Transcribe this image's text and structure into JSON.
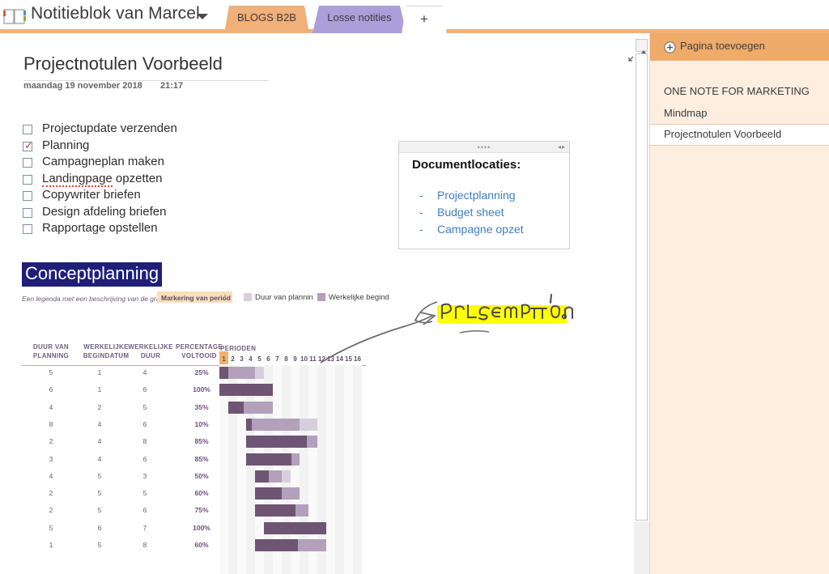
{
  "topbar": {
    "notebook_title": "Notitieblok van Marcel",
    "notebook_icon": "notebook-icon",
    "caret_icon": "chevron-down-icon",
    "tabs": [
      {
        "label": "BLOGS B2B",
        "color": "#efb07a",
        "active": true
      },
      {
        "label": "Losse notities",
        "color": "#ac9ed9",
        "active": false
      }
    ],
    "add_tab_label": "+"
  },
  "page": {
    "title": "Projectnotulen Voorbeeld",
    "date": "maandag 19 november 2018",
    "time": "21:17",
    "expand_icon": "expand-arrows-icon"
  },
  "checklist": [
    {
      "label": "Projectupdate verzenden",
      "checked": false,
      "misspelled": false
    },
    {
      "label": "Planning",
      "checked": true,
      "misspelled": false
    },
    {
      "label": "Campagneplan maken",
      "checked": false,
      "misspelled": false
    },
    {
      "label": "Landingpage opzetten",
      "checked": false,
      "misspelled": true,
      "misspelled_word": "Landingpage",
      "rest": " opzetten"
    },
    {
      "label": "Copywriter briefen",
      "checked": false,
      "misspelled": false
    },
    {
      "label": "Design afdeling briefen",
      "checked": false,
      "misspelled": false
    },
    {
      "label": "Rapportage opstellen",
      "checked": false,
      "misspelled": false
    }
  ],
  "doc_box": {
    "title": "Documentlocaties:",
    "dots": "••••",
    "resize_arrows": "◂▸",
    "links": [
      "Projectplanning",
      "Budget sheet",
      "Campagne opzet"
    ],
    "dash": "-",
    "link_color": "#3d7fc1"
  },
  "section_heading": {
    "text": "Conceptplanning",
    "bg": "#1f1f7a",
    "fg": "#ffffff"
  },
  "annotation": {
    "text": "PRESENTATION!",
    "highlight_color": "#ffff00",
    "ink_color": "#555555",
    "arrow": "curved-arrow"
  },
  "chart_data": {
    "type": "bar",
    "title": "Conceptplanning",
    "legend_note": "Een legenda met een beschrijving van de grafiek",
    "legend": [
      {
        "label": "Markering van period",
        "value": "1",
        "color": "#fadfbb"
      },
      {
        "label": "Duur van plannin",
        "color": "#d8cfdc"
      },
      {
        "label": "Werkelijke begind",
        "color": "#b3a0bb"
      }
    ],
    "columns": [
      "DUUR VAN PLANNING",
      "WERKELIJKE BEGINDATUM",
      "WERKELIJKE DUUR",
      "PERCENTAGE VOLTOOID"
    ],
    "column_lines": [
      [
        "DUUR VAN",
        "PLANNING"
      ],
      [
        "WERKELIJKE",
        "BEGINDATUM"
      ],
      [
        "WERKELIJKE",
        "DUUR"
      ],
      [
        "PERCENTAGE",
        "VOLTOOID"
      ]
    ],
    "periods_label": "PERIODEN",
    "periods": [
      1,
      2,
      3,
      4,
      5,
      6,
      7,
      8,
      9,
      10,
      11,
      12,
      13,
      14,
      15,
      16
    ],
    "period_highlight": 1,
    "xlabel": "PERIODEN",
    "ylabel": "",
    "rows": [
      {
        "duur_planning": 5,
        "begindatum": 1,
        "werkelijke_duur": 4,
        "percentage": "25%",
        "start": 1,
        "plan_len": 5,
        "act_start": 1,
        "act_len": 4,
        "pct": 25
      },
      {
        "duur_planning": 6,
        "begindatum": 1,
        "werkelijke_duur": 6,
        "percentage": "100%",
        "start": 1,
        "plan_len": 6,
        "act_start": 1,
        "act_len": 6,
        "pct": 100
      },
      {
        "duur_planning": 4,
        "begindatum": 2,
        "werkelijke_duur": 5,
        "percentage": "35%",
        "start": 2,
        "plan_len": 4,
        "act_start": 2,
        "act_len": 5,
        "pct": 35
      },
      {
        "duur_planning": 8,
        "begindatum": 4,
        "werkelijke_duur": 6,
        "percentage": "10%",
        "start": 4,
        "plan_len": 8,
        "act_start": 4,
        "act_len": 6,
        "pct": 10
      },
      {
        "duur_planning": 2,
        "begindatum": 4,
        "werkelijke_duur": 8,
        "percentage": "85%",
        "start": 4,
        "plan_len": 2,
        "act_start": 4,
        "act_len": 8,
        "pct": 85
      },
      {
        "duur_planning": 3,
        "begindatum": 4,
        "werkelijke_duur": 6,
        "percentage": "85%",
        "start": 4,
        "plan_len": 3,
        "act_start": 4,
        "act_len": 6,
        "pct": 85
      },
      {
        "duur_planning": 4,
        "begindatum": 5,
        "werkelijke_duur": 3,
        "percentage": "50%",
        "start": 5,
        "plan_len": 4,
        "act_start": 5,
        "act_len": 3,
        "pct": 50
      },
      {
        "duur_planning": 2,
        "begindatum": 5,
        "werkelijke_duur": 5,
        "percentage": "60%",
        "start": 5,
        "plan_len": 2,
        "act_start": 5,
        "act_len": 5,
        "pct": 60
      },
      {
        "duur_planning": 2,
        "begindatum": 5,
        "werkelijke_duur": 6,
        "percentage": "75%",
        "start": 5,
        "plan_len": 2,
        "act_start": 5,
        "act_len": 6,
        "pct": 75
      },
      {
        "duur_planning": 5,
        "begindatum": 6,
        "werkelijke_duur": 7,
        "percentage": "100%",
        "start": 6,
        "plan_len": 5,
        "act_start": 6,
        "act_len": 7,
        "pct": 100
      },
      {
        "duur_planning": 1,
        "begindatum": 5,
        "werkelijke_duur": 8,
        "percentage": "60%",
        "start": 5,
        "plan_len": 1,
        "act_start": 5,
        "act_len": 8,
        "pct": 60
      }
    ],
    "colors": {
      "dark_purple": "#6e5574",
      "light_purple": "#b3a0bb",
      "pale_purple": "#d8cfdc",
      "orange": "#eda938",
      "tan": "#dfc2a0",
      "marker_col": "#f8dfba"
    }
  },
  "scrollbar": {
    "up_arrow": "scroll-up-arrow-icon"
  },
  "panel": {
    "add_page_label": "Pagina toevoegen",
    "add_page_icon": "plus-circle-icon",
    "pages": [
      {
        "label": "ONE NOTE FOR MARKETING",
        "selected": false
      },
      {
        "label": "Mindmap",
        "selected": false
      },
      {
        "label": "Projectnotulen Voorbeeld",
        "selected": true
      }
    ],
    "bg": "#fdeee0",
    "header_bg": "#efab6a"
  }
}
